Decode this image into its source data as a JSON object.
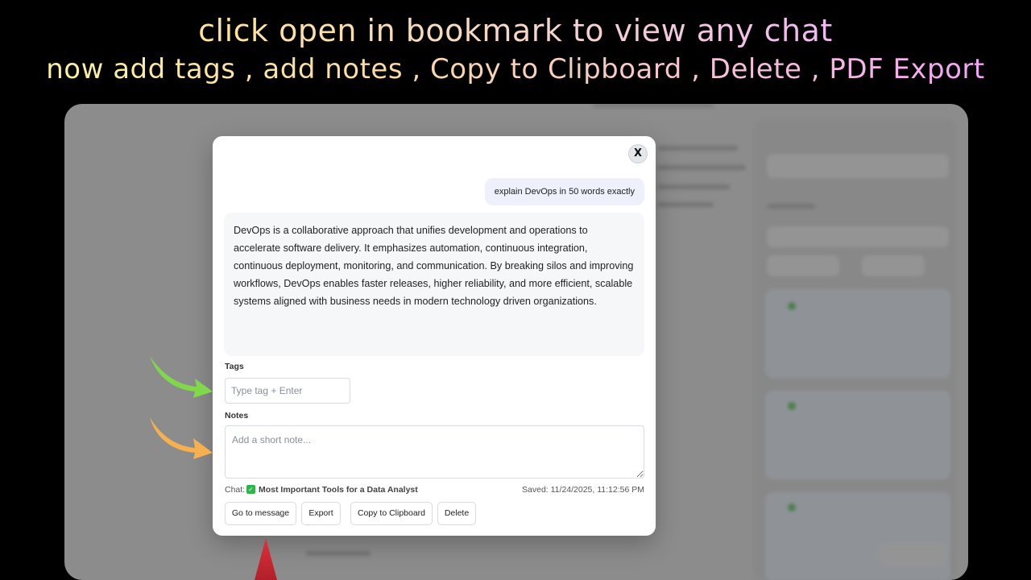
{
  "headline": {
    "line1": "click open in bookmark to view any chat",
    "line2": "now add tags , add notes , Copy to Clipboard , Delete , PDF Export"
  },
  "modal": {
    "close_label": "X",
    "user_message": "explain DevOps in 50 words exactly",
    "answer": "DevOps is a collaborative approach that unifies development and operations to accelerate software delivery. It emphasizes automation, continuous integration, continuous deployment, monitoring, and communication. By breaking silos and improving workflows, DevOps enables faster releases, higher reliability, and more efficient, scalable systems aligned with business needs in modern technology driven organizations.",
    "tags_label": "Tags",
    "tags_placeholder": "Type tag + Enter",
    "notes_label": "Notes",
    "notes_placeholder": "Add a short note...",
    "chat_prefix": "Chat:",
    "chat_name": "Most Important Tools for a Data Analyst",
    "saved": "Saved: 11/24/2025, 11:12:56 PM",
    "buttons": {
      "go_to_message": "Go to message",
      "export": "Export",
      "copy": "Copy to Clipboard",
      "delete": "Delete"
    }
  },
  "colors": {
    "arrow_green": "#7fd94a",
    "arrow_orange": "#f5b04f",
    "arrow_red": "#e0313b",
    "check_green": "#2fb34b"
  },
  "icons": {
    "check": "check-square-icon",
    "close": "close-icon"
  }
}
